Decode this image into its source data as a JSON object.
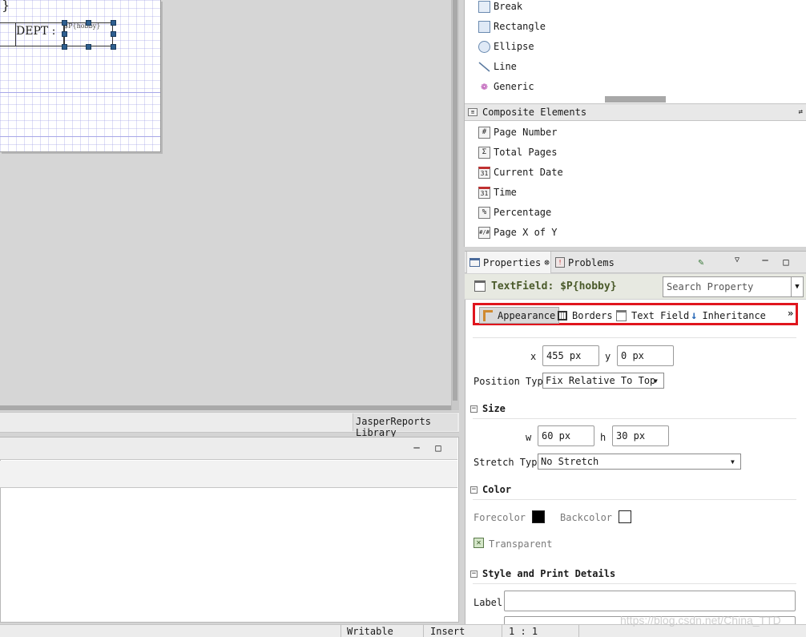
{
  "canvas": {
    "brace": "}",
    "dept_label": "DEPT :",
    "hobby_expr": "$P{hobby}",
    "library_tab": "JasperReports Library"
  },
  "palette": {
    "basic_items": [
      {
        "label": "Break",
        "icon": "break-icon"
      },
      {
        "label": "Rectangle",
        "icon": "rectangle-icon"
      },
      {
        "label": "Ellipse",
        "icon": "ellipse-icon"
      },
      {
        "label": "Line",
        "icon": "line-icon"
      },
      {
        "label": "Generic",
        "icon": "generic-icon"
      }
    ],
    "composite_header": "Composite Elements",
    "composite_items": [
      {
        "label": "Page Number",
        "glyph": "#"
      },
      {
        "label": "Total Pages",
        "glyph": "Σ"
      },
      {
        "label": "Current Date",
        "glyph": "31"
      },
      {
        "label": "Time",
        "glyph": "31"
      },
      {
        "label": "Percentage",
        "glyph": "%"
      },
      {
        "label": "Page X of Y",
        "glyph": "#/#"
      }
    ]
  },
  "properties": {
    "tab_properties": "Properties",
    "tab_problems": "Problems",
    "title": "TextField: $P{hobby}",
    "search_placeholder": "Search Property",
    "subtabs": [
      "Appearance",
      "Borders",
      "Text Field",
      "Inheritance"
    ],
    "more": "»",
    "location": {
      "x_label": "x",
      "x_value": "455 px",
      "y_label": "y",
      "y_value": "0 px"
    },
    "position_type_label": "Position Type",
    "position_type_value": "Fix Relative To Top",
    "size_section": "Size",
    "size": {
      "w_label": "w",
      "w_value": "60 px",
      "h_label": "h",
      "h_value": "30 px"
    },
    "stretch_type_label": "Stretch Type",
    "stretch_type_value": "No Stretch",
    "color_section": "Color",
    "forecolor_label": "Forecolor",
    "forecolor": "#000000",
    "backcolor_label": "Backcolor",
    "backcolor": "#ffffff",
    "transparent_label": "Transparent",
    "transparent_checked": true,
    "style_section": "Style and Print Details",
    "label_label": "Label",
    "label_value": ""
  },
  "statusbar": {
    "writable": "Writable",
    "insert": "Insert",
    "position": "1 : 1"
  },
  "watermark": "https://blog.csdn.net/China_TTD",
  "colors": {
    "highlight_red": "#e0151d",
    "handle_blue": "#2f5f8f",
    "title_olive": "#4a5a2a"
  }
}
